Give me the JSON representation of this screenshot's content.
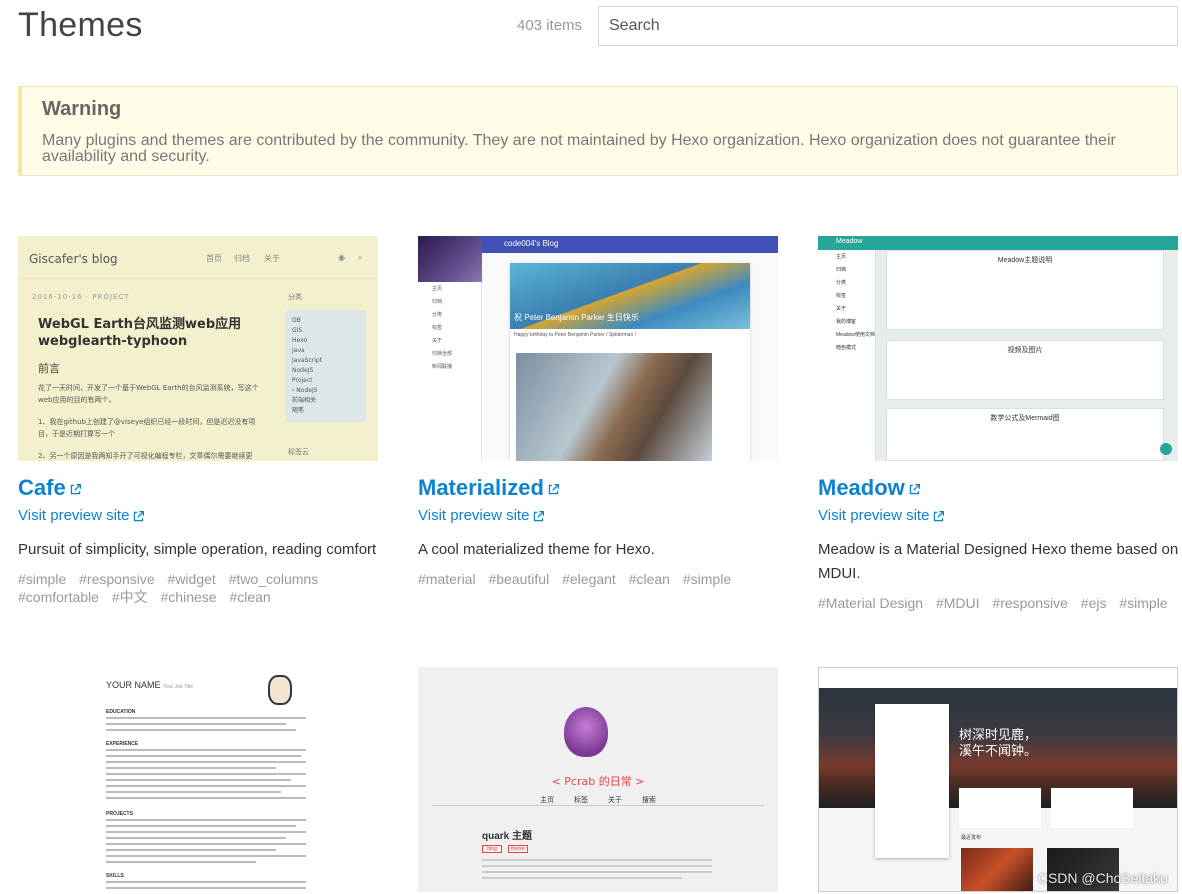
{
  "header": {
    "title": "Themes",
    "item_count": "403 items",
    "search_placeholder": "Search"
  },
  "warning": {
    "title": "Warning",
    "text": "Many plugins and themes are contributed by the community. They are not maintained by Hexo organization. Hexo organization does not guarantee their availability and security."
  },
  "visit_label": "Visit preview site",
  "themes": [
    {
      "name": "Cafe",
      "description": "Pursuit of simplicity, simple operation, reading comfort",
      "tags": [
        "#simple",
        "#responsive",
        "#widget",
        "#two_columns",
        "#comfortable",
        "#中文",
        "#chinese",
        "#clean"
      ],
      "thumb": {
        "blog_title": "Giscafer's blog",
        "nav": [
          "首页",
          "归档",
          "关于"
        ],
        "date": "2016-10-16 · PROJECT",
        "post_title": "WebGL Earth台风监测web应用 webglearth-typhoon",
        "heading": "前言",
        "paragraph1": "花了一天时间，开发了一个基于WebGL Earth的台风监测系统，写这个web应用的目的有两个。",
        "paragraph2": "1、我在github上创建了@viseye组织已经一段时间，但是迟迟没有项目，于是近期打算写一个",
        "paragraph3": "2、另一个原因是我两知手开了可视化编程专栏，文章偶尔需要继续更",
        "side_title": "分类",
        "categories": [
          "DB",
          "GIS",
          "Hexo",
          "Java",
          "JavaScript",
          "NodeJS",
          "Project",
          "› NodeJS",
          "前端相关",
          "随笔"
        ],
        "side_title2": "标签云"
      }
    },
    {
      "name": "Materialized",
      "description": "A cool materialized theme for Hexo.",
      "tags": [
        "#material",
        "#beautiful",
        "#elegant",
        "#clean",
        "#simple"
      ],
      "thumb": {
        "blog_title": "code004's Blog",
        "menu": [
          "主页",
          "归档",
          "分类",
          "标签",
          "关于",
          "归档全部",
          "新闻联播"
        ],
        "post_title": "祝 Peter Benjamin Parker 生日快乐",
        "post_text": "Happy birthday to Peter Benjamin Parker / Spiderman !"
      }
    },
    {
      "name": "Meadow",
      "description": "Meadow is a Material Designed Hexo theme based on MDUI.",
      "tags": [
        "#Material Design",
        "#MDUI",
        "#responsive",
        "#ejs",
        "#simple"
      ],
      "thumb": {
        "blog_title": "Meadow",
        "menu": [
          "主页",
          "归档",
          "分类",
          "标签",
          "关于",
          "我的博客",
          "Meadow使用文档",
          "暗色模式"
        ],
        "posts": [
          "Meadow主题说明",
          "视频及图片",
          "数学公式及Mermaid图"
        ]
      }
    },
    {
      "name": "",
      "description": "",
      "tags": [],
      "thumb": {
        "name": "YOUR NAME",
        "subtitle": "Your Job Title",
        "sections": [
          "EDUCATION",
          "EXPERIENCE",
          "PROJECTS",
          "SKILLS"
        ]
      }
    },
    {
      "name": "",
      "description": "",
      "tags": [],
      "thumb": {
        "title": "< Pcrab 的日常 >",
        "nav": "主页 标签 关于 搜索",
        "post_title": "quark 主题",
        "tags": [
          "blog",
          "theme"
        ]
      }
    },
    {
      "name": "",
      "description": "",
      "tags": [],
      "thumb": {
        "hero_text_1": "树深时见鹿，",
        "hero_text_2": "溪午不闻钟。",
        "section": "最近发布"
      }
    }
  ],
  "watermark": "CSDN @ChoSeitaku",
  "colors": {
    "link": "#0e83cd",
    "warning_bg": "#fffde8"
  }
}
